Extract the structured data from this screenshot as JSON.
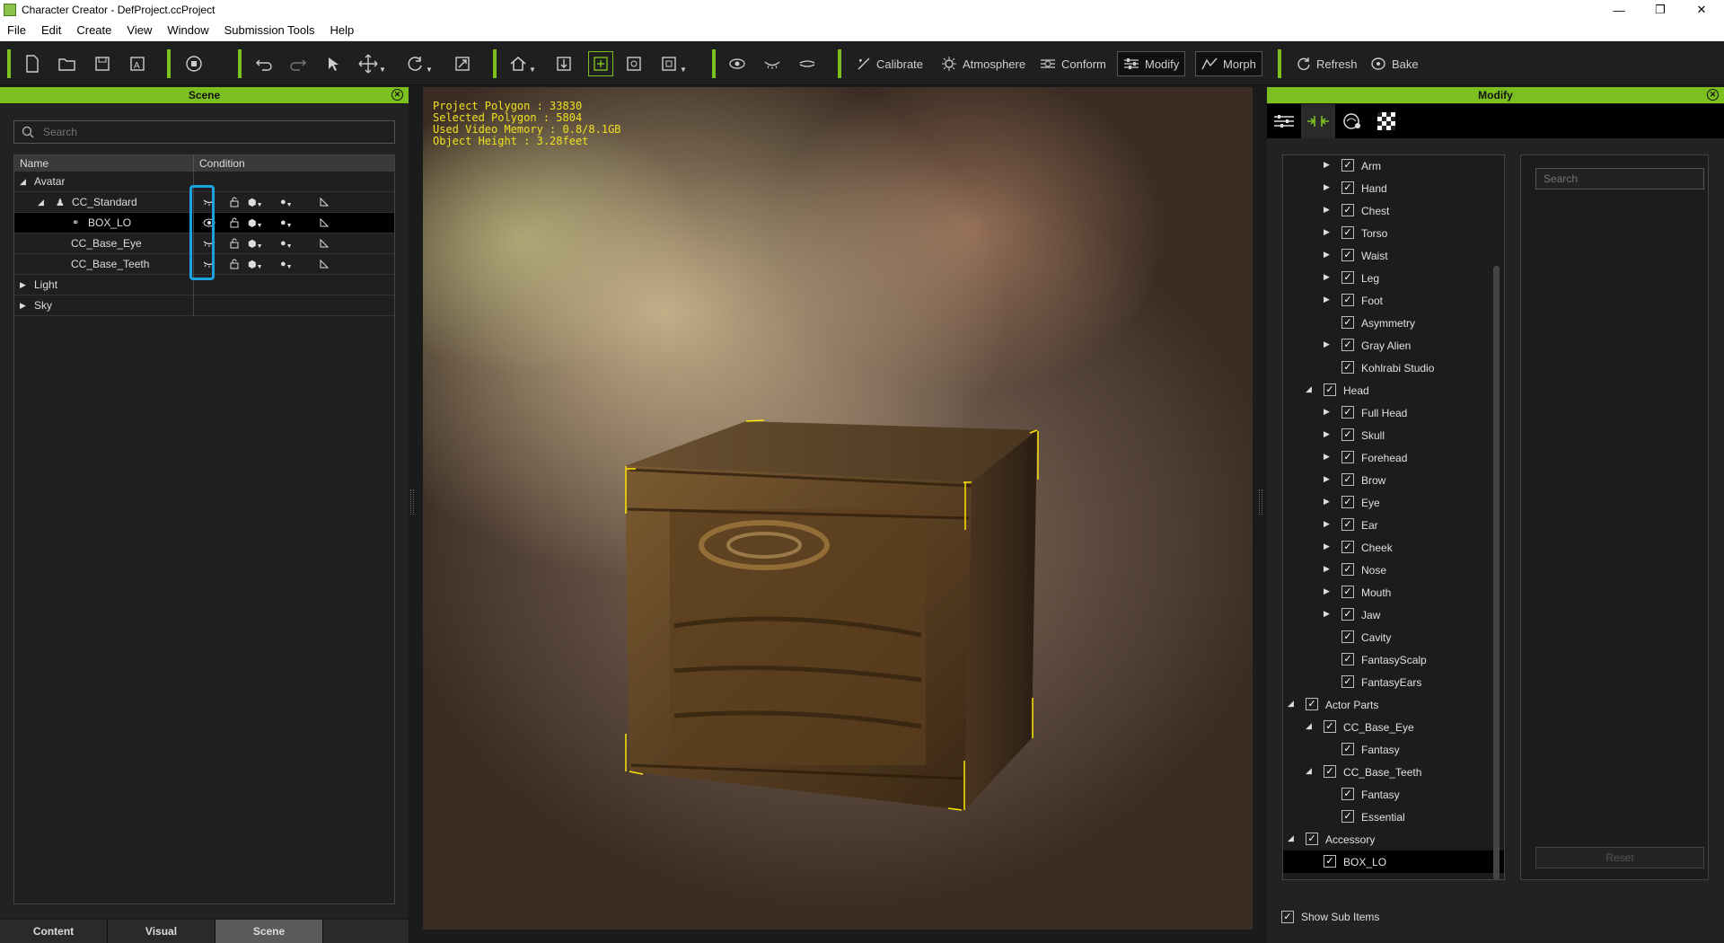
{
  "window": {
    "title": "Character Creator - DefProject.ccProject"
  },
  "menu": [
    "File",
    "Edit",
    "Create",
    "View",
    "Window",
    "Submission Tools",
    "Help"
  ],
  "toolbar": {
    "calibrate": "Calibrate",
    "atmosphere": "Atmosphere",
    "conform": "Conform",
    "modify": "Modify",
    "morph": "Morph",
    "refresh": "Refresh",
    "bake": "Bake"
  },
  "scene": {
    "header": "Scene",
    "search_placeholder": "Search",
    "col_name": "Name",
    "col_condition": "Condition",
    "rows": [
      {
        "label": "Avatar"
      },
      {
        "label": "CC_Standard"
      },
      {
        "label": "BOX_LO"
      },
      {
        "label": "CC_Base_Eye"
      },
      {
        "label": "CC_Base_Teeth"
      },
      {
        "label": "Light"
      },
      {
        "label": "Sky"
      }
    ],
    "tabs": [
      "Content",
      "Visual",
      "Scene"
    ],
    "active_tab": "Scene"
  },
  "viewport": {
    "stats": [
      "Project Polygon : 33830",
      "Selected Polygon : 5804",
      "Used Video Memory : 0.8/8.1GB",
      "Object Height : 3.28feet"
    ]
  },
  "modify": {
    "header": "Modify",
    "search_placeholder": "Search",
    "reset_label": "Reset",
    "show_sub_items": "Show Sub Items",
    "tree": [
      {
        "label": "Arm"
      },
      {
        "label": "Hand"
      },
      {
        "label": "Chest"
      },
      {
        "label": "Torso"
      },
      {
        "label": "Waist"
      },
      {
        "label": "Leg"
      },
      {
        "label": "Foot"
      },
      {
        "label": "Asymmetry"
      },
      {
        "label": "Gray Alien"
      },
      {
        "label": "Kohlrabi Studio"
      },
      {
        "label": "Head"
      },
      {
        "label": "Full Head"
      },
      {
        "label": "Skull"
      },
      {
        "label": "Forehead"
      },
      {
        "label": "Brow"
      },
      {
        "label": "Eye"
      },
      {
        "label": "Ear"
      },
      {
        "label": "Cheek"
      },
      {
        "label": "Nose"
      },
      {
        "label": "Mouth"
      },
      {
        "label": "Jaw"
      },
      {
        "label": "Cavity"
      },
      {
        "label": "FantasyScalp"
      },
      {
        "label": "FantasyEars"
      },
      {
        "label": "Actor Parts"
      },
      {
        "label": "CC_Base_Eye"
      },
      {
        "label": "Fantasy"
      },
      {
        "label": "CC_Base_Teeth"
      },
      {
        "label": "Fantasy"
      },
      {
        "label": "Essential"
      },
      {
        "label": "Accessory"
      },
      {
        "label": "BOX_LO"
      }
    ]
  },
  "colors": {
    "accent": "#7cc020",
    "highlight": "#1aa3e0",
    "stats": "#f0e020"
  }
}
